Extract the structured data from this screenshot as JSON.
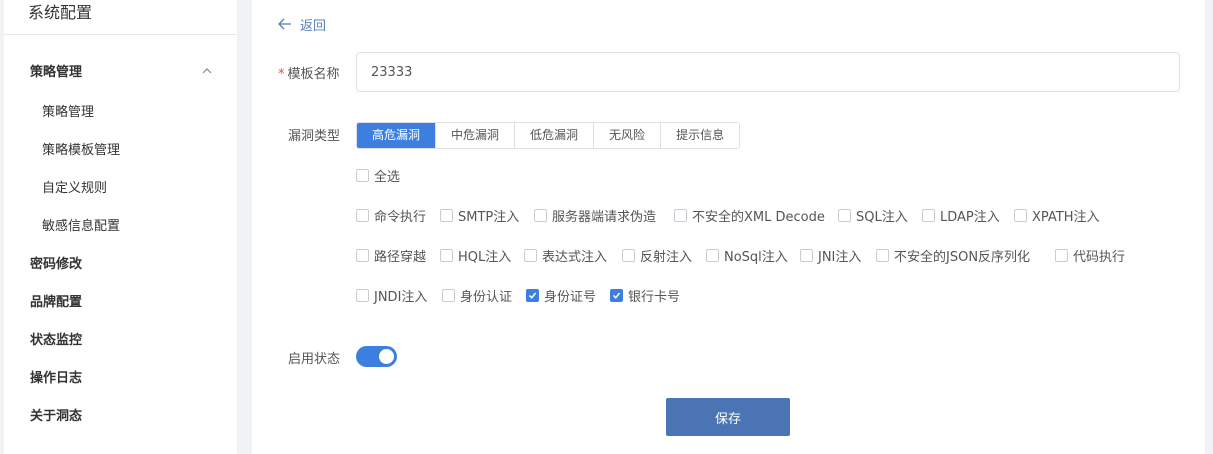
{
  "sidebar": {
    "title": "系统配置",
    "group": {
      "label": "策略管理",
      "expanded": true
    },
    "sub_items": [
      "策略管理",
      "策略模板管理",
      "自定义规则",
      "敏感信息配置"
    ],
    "top_items": [
      "密码修改",
      "品牌配置",
      "状态监控",
      "操作日志",
      "关于洞态"
    ]
  },
  "main": {
    "back_label": "返回",
    "template_name": {
      "required_mark": "*",
      "label": "模板名称",
      "value": "23333"
    },
    "vuln_type": {
      "label": "漏洞类型",
      "tabs": [
        "高危漏洞",
        "中危漏洞",
        "低危漏洞",
        "无风险",
        "提示信息"
      ],
      "active_tab": "高危漏洞"
    },
    "select_all": {
      "label": "全选",
      "checked": false
    },
    "options_row1": [
      {
        "label": "命令执行",
        "checked": false
      },
      {
        "label": "SMTP注入",
        "checked": false
      },
      {
        "label": "服务器端请求伪造",
        "checked": false
      },
      {
        "label": "不安全的XML Decode",
        "checked": false
      },
      {
        "label": "SQL注入",
        "checked": false
      },
      {
        "label": "LDAP注入",
        "checked": false
      },
      {
        "label": "XPATH注入",
        "checked": false
      }
    ],
    "options_row2": [
      {
        "label": "路径穿越",
        "checked": false
      },
      {
        "label": "HQL注入",
        "checked": false
      },
      {
        "label": "表达式注入",
        "checked": false
      },
      {
        "label": "反射注入",
        "checked": false
      },
      {
        "label": "NoSql注入",
        "checked": false
      },
      {
        "label": "JNI注入",
        "checked": false
      },
      {
        "label": "不安全的JSON反序列化",
        "checked": false
      },
      {
        "label": "代码执行",
        "checked": false
      }
    ],
    "options_row3": [
      {
        "label": "JNDI注入",
        "checked": false
      },
      {
        "label": "身份认证",
        "checked": false
      },
      {
        "label": "身份证号",
        "checked": true
      },
      {
        "label": "银行卡号",
        "checked": true
      }
    ],
    "enable": {
      "label": "启用状态",
      "on": true
    },
    "save_label": "保存"
  },
  "colors": {
    "accent": "#3d7fe0",
    "save_button": "#4a74b4",
    "required": "#e0504f"
  }
}
